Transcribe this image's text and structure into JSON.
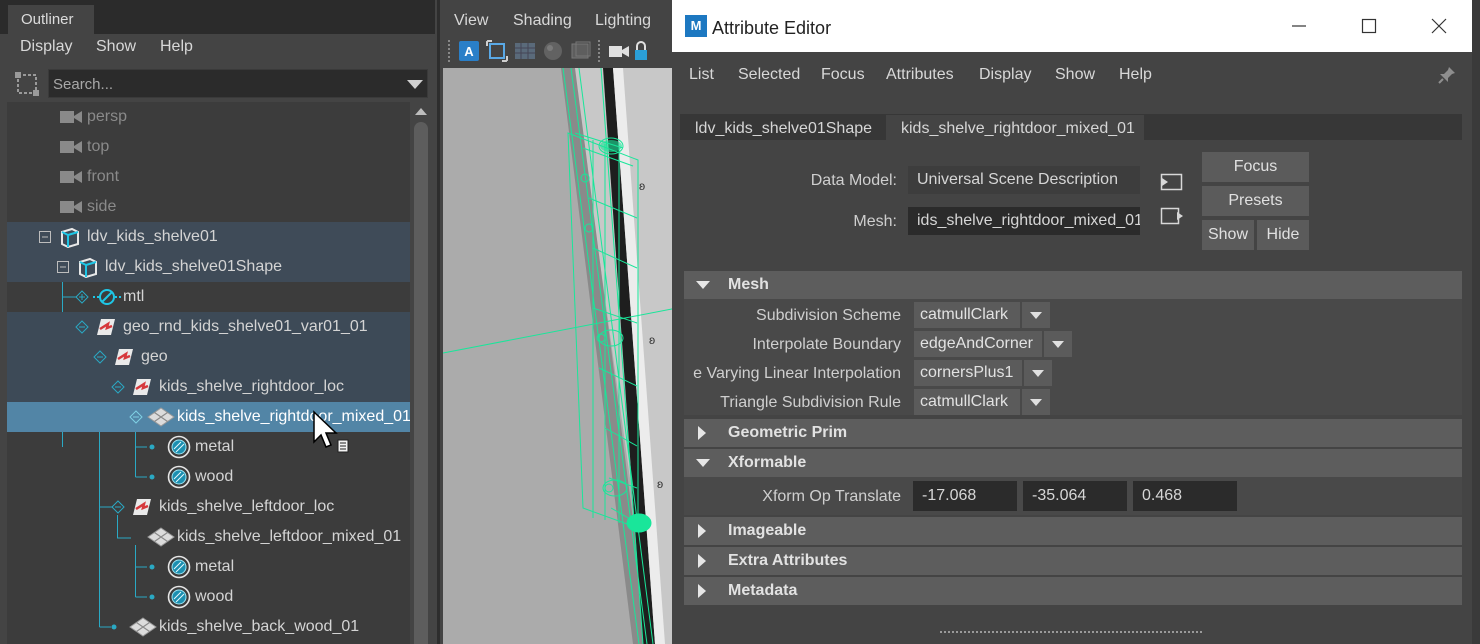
{
  "outliner": {
    "tab_label": "Outliner",
    "menu": [
      "Display",
      "Show",
      "Help"
    ],
    "search": {
      "placeholder": "Search..."
    },
    "items": [
      {
        "label": "persp",
        "icon": "camera-icon"
      },
      {
        "label": "top",
        "icon": "camera-icon"
      },
      {
        "label": "front",
        "icon": "camera-icon"
      },
      {
        "label": "side",
        "icon": "camera-icon"
      },
      {
        "label": "ldv_kids_shelve01",
        "icon": "usd-proxy-icon"
      },
      {
        "label": "ldv_kids_shelve01Shape",
        "icon": "usd-proxy-icon"
      },
      {
        "label": "mtl",
        "icon": "material-scope-icon"
      },
      {
        "label": "geo_rnd_kids_shelve01_var01_01",
        "icon": "xform-icon"
      },
      {
        "label": "geo",
        "icon": "xform-icon"
      },
      {
        "label": "kids_shelve_rightdoor_loc",
        "icon": "xform-icon"
      },
      {
        "label": "kids_shelve_rightdoor_mixed_01",
        "icon": "mesh-icon"
      },
      {
        "label": "metal",
        "icon": "geomsubset-icon"
      },
      {
        "label": "wood",
        "icon": "geomsubset-icon"
      },
      {
        "label": "kids_shelve_leftdoor_loc",
        "icon": "xform-icon"
      },
      {
        "label": "kids_shelve_leftdoor_mixed_01",
        "icon": "mesh-icon"
      },
      {
        "label": "metal",
        "icon": "geomsubset-icon"
      },
      {
        "label": "wood",
        "icon": "geomsubset-icon"
      },
      {
        "label": "kids_shelve_back_wood_01",
        "icon": "mesh-icon"
      }
    ]
  },
  "viewport": {
    "menu": [
      "View",
      "Shading",
      "Lighting"
    ],
    "toolbar_icons": [
      "select-camera-icon",
      "frame-all-icon",
      "grid-icon",
      "shaded-icon",
      "wireframe-icon",
      "camera-attr-icon",
      "lock-icon"
    ],
    "accent_color": "#00ff99"
  },
  "attribute_editor": {
    "title": "Attribute Editor",
    "app_icon_letter": "M",
    "menu": [
      "List",
      "Selected",
      "Focus",
      "Attributes",
      "Display",
      "Show",
      "Help"
    ],
    "tabs": [
      "ldv_kids_shelve01Shape",
      "kids_shelve_rightdoor_mixed_01"
    ],
    "data_model_label": "Data Model:",
    "data_model_value": "Universal Scene Description",
    "mesh_label": "Mesh:",
    "mesh_value": "ids_shelve_rightdoor_mixed_01",
    "buttons": {
      "focus": "Focus",
      "presets": "Presets",
      "show": "Show",
      "hide": "Hide"
    },
    "sections": {
      "mesh": "Mesh",
      "geometric_prim": "Geometric Prim",
      "xformable": "Xformable",
      "imageable": "Imageable",
      "extra_attributes": "Extra Attributes",
      "metadata": "Metadata"
    },
    "mesh_attrs": [
      {
        "label": "Subdivision Scheme",
        "value": "catmullClark"
      },
      {
        "label": "Interpolate Boundary",
        "value": "edgeAndCorner"
      },
      {
        "label": "e Varying Linear Interpolation",
        "value": "cornersPlus1"
      },
      {
        "label": "Triangle Subdivision Rule",
        "value": "catmullClark"
      }
    ],
    "xform": {
      "label": "Xform Op Translate",
      "values": [
        "-17.068",
        "-35.064",
        "0.468"
      ]
    }
  }
}
